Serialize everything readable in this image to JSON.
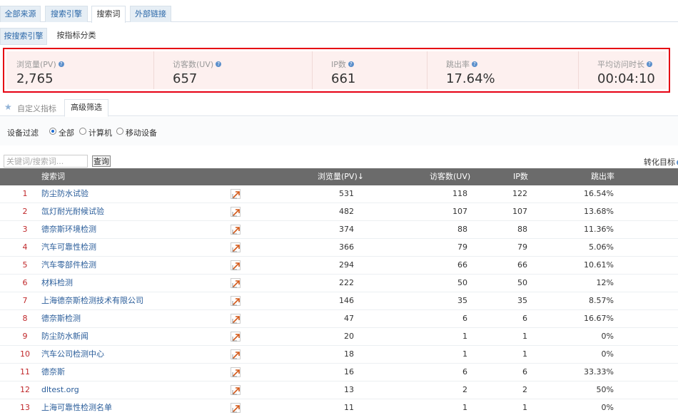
{
  "top_tabs": [
    {
      "label": "全部来源",
      "active": false
    },
    {
      "label": "搜索引擎",
      "active": false
    },
    {
      "label": "搜索词",
      "active": true
    },
    {
      "label": "外部链接",
      "active": false
    }
  ],
  "sub_tabs": [
    {
      "label": "按搜索引擎"
    },
    {
      "label": "按指标分类"
    }
  ],
  "stats": [
    {
      "label": "浏览量(PV)",
      "value": "2,765"
    },
    {
      "label": "访客数(UV)",
      "value": "657"
    },
    {
      "label": "IP数",
      "value": "661"
    },
    {
      "label": "跳出率",
      "value": "17.64%"
    },
    {
      "label": "平均访问时长",
      "value": "00:04:10"
    }
  ],
  "filter_tabs": {
    "custom": "自定义指标",
    "advanced": "高级筛选"
  },
  "device_filter": {
    "label": "设备过滤",
    "options": [
      "全部",
      "计算机",
      "移动设备"
    ],
    "selected": "全部"
  },
  "search": {
    "placeholder": "关键词/搜索词...",
    "button": "查询"
  },
  "conversion_label": "转化目标",
  "table": {
    "headers": {
      "keyword": "搜索词",
      "pv": "浏览量(PV)",
      "uv": "访客数(UV)",
      "ip": "IP数",
      "bounce": "跳出率"
    },
    "rows": [
      {
        "idx": "1",
        "keyword": "防尘防水试验",
        "pv": "531",
        "uv": "118",
        "ip": "122",
        "bounce": "16.54%"
      },
      {
        "idx": "2",
        "keyword": "氙灯耐光耐候试验",
        "pv": "482",
        "uv": "107",
        "ip": "107",
        "bounce": "13.68%"
      },
      {
        "idx": "3",
        "keyword": "德奈斯环境检测",
        "pv": "374",
        "uv": "88",
        "ip": "88",
        "bounce": "11.36%"
      },
      {
        "idx": "4",
        "keyword": "汽车可靠性检测",
        "pv": "366",
        "uv": "79",
        "ip": "79",
        "bounce": "5.06%"
      },
      {
        "idx": "5",
        "keyword": "汽车零部件检测",
        "pv": "294",
        "uv": "66",
        "ip": "66",
        "bounce": "10.61%"
      },
      {
        "idx": "6",
        "keyword": "材料检测",
        "pv": "222",
        "uv": "50",
        "ip": "50",
        "bounce": "12%"
      },
      {
        "idx": "7",
        "keyword": "上海德奈斯检测技术有限公司",
        "pv": "146",
        "uv": "35",
        "ip": "35",
        "bounce": "8.57%"
      },
      {
        "idx": "8",
        "keyword": "德奈斯检测",
        "pv": "47",
        "uv": "6",
        "ip": "6",
        "bounce": "16.67%"
      },
      {
        "idx": "9",
        "keyword": "防尘防水新闻",
        "pv": "20",
        "uv": "1",
        "ip": "1",
        "bounce": "0%"
      },
      {
        "idx": "10",
        "keyword": "汽车公司检测中心",
        "pv": "18",
        "uv": "1",
        "ip": "1",
        "bounce": "0%"
      },
      {
        "idx": "11",
        "keyword": "德奈斯",
        "pv": "16",
        "uv": "6",
        "ip": "6",
        "bounce": "33.33%"
      },
      {
        "idx": "12",
        "keyword": "dltest.org",
        "pv": "13",
        "uv": "2",
        "ip": "2",
        "bounce": "50%"
      },
      {
        "idx": "13",
        "keyword": "上海可靠性检测名单",
        "pv": "11",
        "uv": "1",
        "ip": "1",
        "bounce": "0%"
      }
    ]
  },
  "colors": {
    "highlight_border": "#e60012",
    "stats_bg": "#fdf0ef",
    "header_bg": "#6b6b6b",
    "link": "#2a5d9a",
    "index": "#c0282b"
  }
}
